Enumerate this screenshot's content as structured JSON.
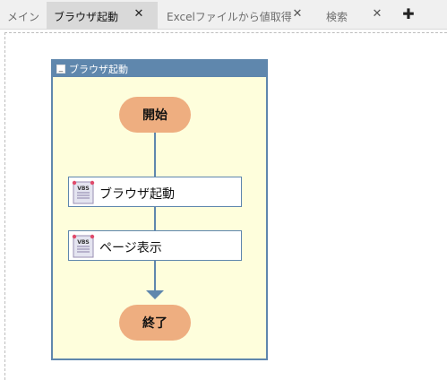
{
  "tabs": [
    {
      "label": "メイン",
      "closable": false,
      "active": false
    },
    {
      "label": "ブラウザ起動",
      "closable": true,
      "active": true
    },
    {
      "label": "Excelファイルから値取得",
      "closable": true,
      "active": false
    },
    {
      "label": "検索",
      "closable": true,
      "active": false
    }
  ],
  "add_tab_label": "✚",
  "close_glyph": "✕",
  "group": {
    "title": "ブラウザ起動",
    "collapse_glyph": "_"
  },
  "flow": {
    "start": "開始",
    "steps": [
      {
        "label": "ブラウザ起動",
        "icon": "vbs-script-icon",
        "icon_text": "VBS"
      },
      {
        "label": "ページ表示",
        "icon": "vbs-script-icon",
        "icon_text": "VBS"
      }
    ],
    "end": "終了"
  },
  "colors": {
    "accent": "#5f87ad",
    "group_bg": "#fefedc",
    "terminal": "#eeae80"
  }
}
